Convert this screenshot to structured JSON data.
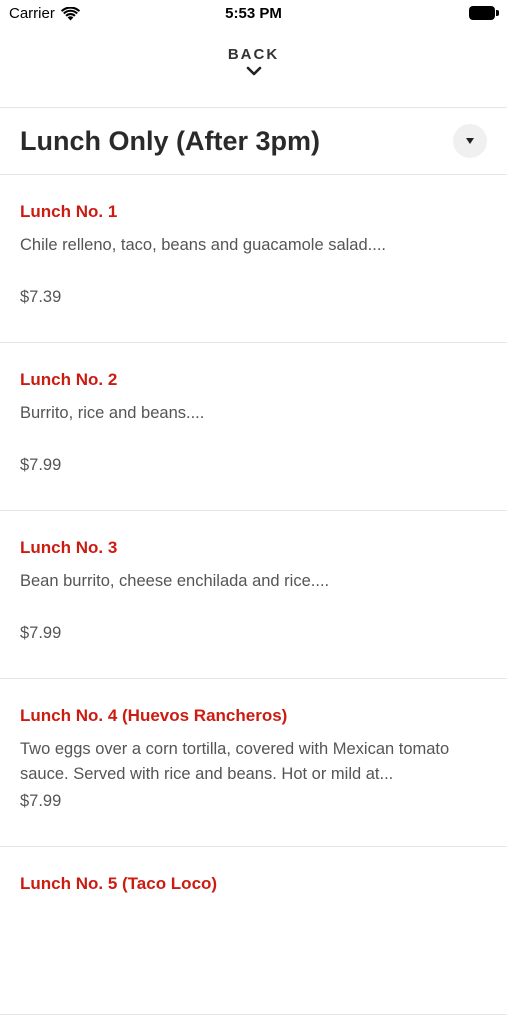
{
  "status_bar": {
    "carrier": "Carrier",
    "time": "5:53 PM"
  },
  "nav": {
    "back_label": "BACK"
  },
  "category": {
    "title": "Lunch Only (After 3pm)"
  },
  "items": [
    {
      "name": "Lunch No. 1",
      "description": "Chile relleno, taco, beans and guacamole salad....",
      "price": "$7.39"
    },
    {
      "name": "Lunch No. 2",
      "description": "Burrito, rice and beans....",
      "price": "$7.99"
    },
    {
      "name": "Lunch No. 3",
      "description": "Bean burrito, cheese enchilada and rice....",
      "price": "$7.99"
    },
    {
      "name": "Lunch No. 4 (Huevos Rancheros)",
      "description": "Two eggs over a corn tortilla, covered with Mexican tomato sauce. Served with rice and beans. Hot or mild at...",
      "price": "$7.99"
    },
    {
      "name": "Lunch No. 5 (Taco Loco)",
      "description": "",
      "price": ""
    }
  ],
  "colors": {
    "accent": "#cc1c12",
    "text_muted": "#555555",
    "divider": "#e6e6e6"
  }
}
